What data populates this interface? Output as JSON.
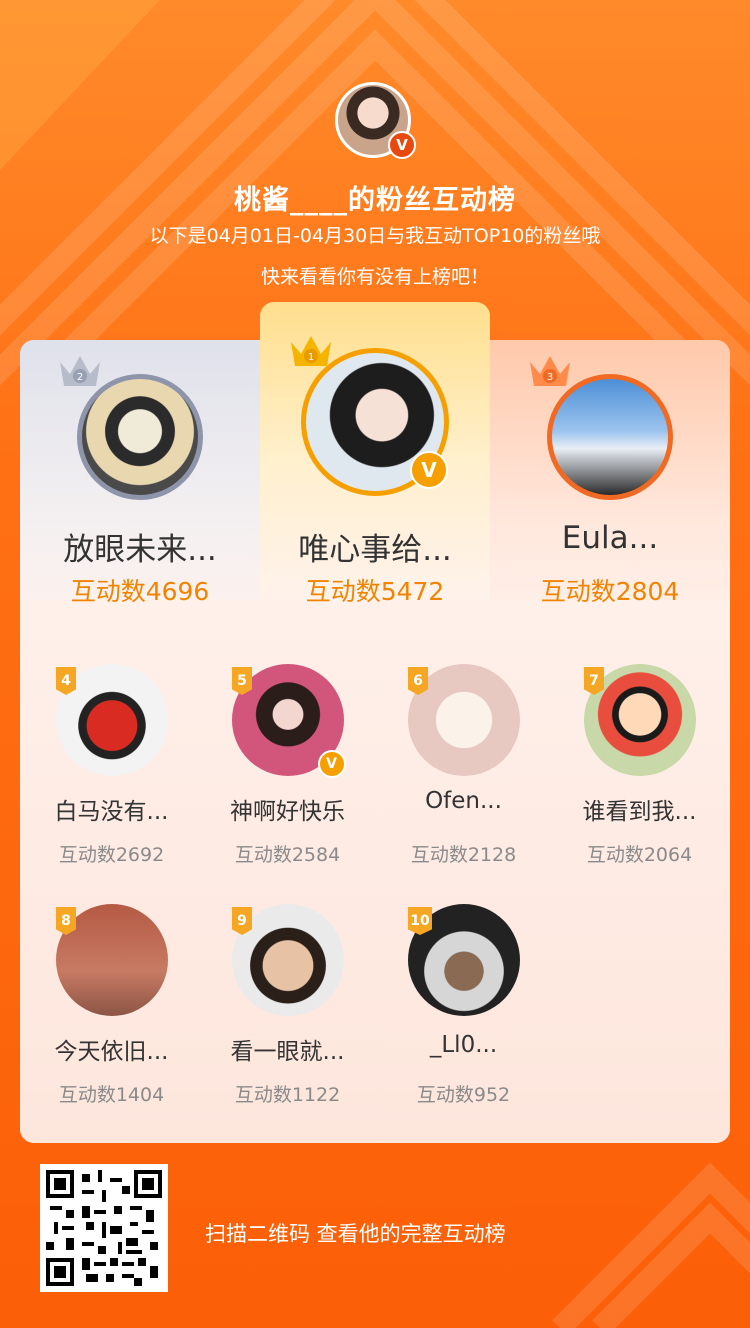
{
  "header": {
    "avatar_icon": "streamer-avatar",
    "verified_icon": "v-badge-icon",
    "verified_text": "V",
    "title": "桃酱____的粉丝互动榜",
    "subtitle": "以下是04月01日-04月30日与我互动TOP10的粉丝哦",
    "subtitle2": "快来看看你有没有上榜吧！"
  },
  "podium": [
    {
      "rank": "2",
      "name": "放眼未来...",
      "count": "互动数4696",
      "crown_color": "#b7bccb",
      "ring_color": "#8e95aa"
    },
    {
      "rank": "1",
      "name": "唯心事给...",
      "count": "互动数5472",
      "crown_color": "#f5b400",
      "ring_color": "#f5a000",
      "verified_text": "V"
    },
    {
      "rank": "3",
      "name": "Eula...",
      "count": "互动数2804",
      "crown_color": "#ff8a4a",
      "ring_color": "#f06a24"
    }
  ],
  "fans": [
    {
      "rank": "4",
      "name": "白马没有...",
      "count": "互动数2692"
    },
    {
      "rank": "5",
      "name": "神啊好快乐",
      "count": "互动数2584",
      "verified_text": "V"
    },
    {
      "rank": "6",
      "name": "Ofen...",
      "count": "互动数2128"
    },
    {
      "rank": "7",
      "name": "谁看到我...",
      "count": "互动数2064"
    },
    {
      "rank": "8",
      "name": "今天依旧...",
      "count": "互动数1404"
    },
    {
      "rank": "9",
      "name": "看一眼就...",
      "count": "互动数1122"
    },
    {
      "rank": "10",
      "name": "_Ll0...",
      "count": "互动数952"
    }
  ],
  "footer": {
    "qr_icon": "qr-code-icon",
    "text": "扫描二维码 查看他的完整互动榜"
  },
  "colors": {
    "accent": "#f08400",
    "background": "#ff7014",
    "rank_badge": "#f5a623"
  }
}
